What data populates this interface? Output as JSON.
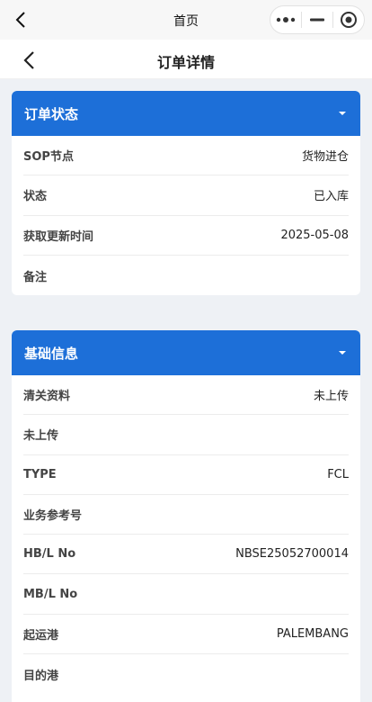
{
  "statusbar": {
    "title": "首页"
  },
  "navbar": {
    "title": "订单详情"
  },
  "order_status": {
    "title": "订单状态",
    "rows": [
      {
        "label": "SOP节点",
        "value": "货物进仓"
      },
      {
        "label": "状态",
        "value": "已入库"
      },
      {
        "label": "获取更新时间",
        "value": "2025-05-08"
      },
      {
        "label": "备注",
        "value": ""
      }
    ]
  },
  "basic_info": {
    "title": "基础信息",
    "rows": [
      {
        "label": "清关资料",
        "value": "未上传"
      },
      {
        "label": "未上传",
        "value": ""
      },
      {
        "label": "TYPE",
        "value": "FCL"
      },
      {
        "label": "业务参考号",
        "value": ""
      },
      {
        "label": "HB/L No",
        "value": "NBSE25052700014"
      },
      {
        "label": "MB/L No",
        "value": ""
      },
      {
        "label": "起运港",
        "value": "PALEMBANG"
      },
      {
        "label": "目的港",
        "value": ""
      }
    ]
  },
  "colors": {
    "header_blue": "#1d6fd8",
    "background": "#eef1f5"
  },
  "icons": [
    "back-chevron-icon",
    "more-dots-icon",
    "minimize-icon",
    "close-target-icon",
    "caret-down-icon"
  ]
}
